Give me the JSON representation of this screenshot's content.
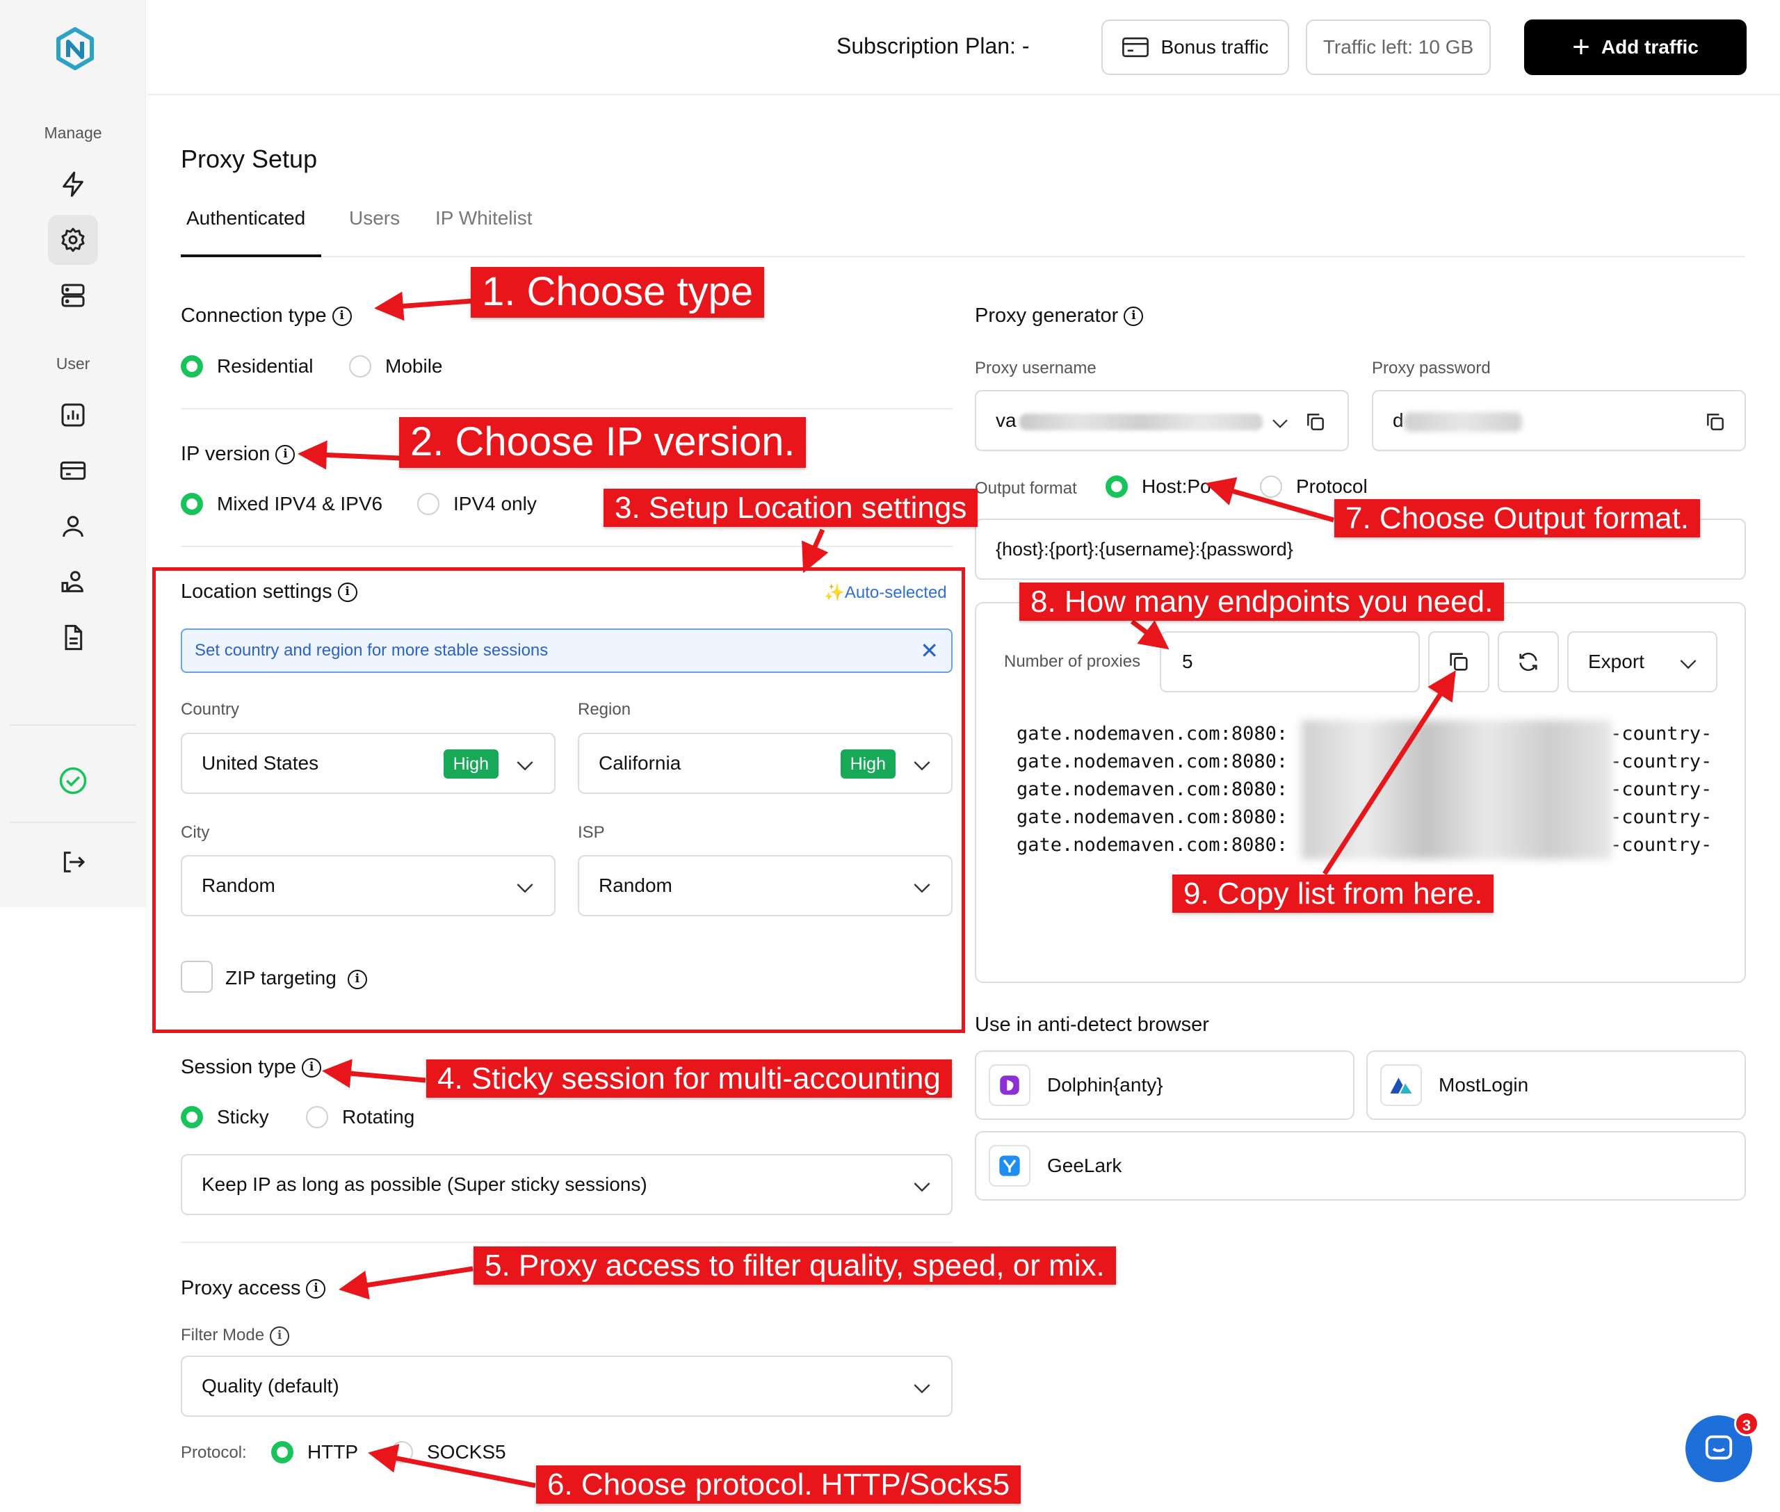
{
  "topbar": {
    "subscription_label": "Subscription Plan: -",
    "bonus_traffic": "Bonus traffic",
    "traffic_left": "Traffic left: 10 GB",
    "add_traffic": "Add traffic"
  },
  "sidebar": {
    "manage_label": "Manage",
    "user_label": "User",
    "items": [
      "bolt-icon",
      "gear-icon",
      "server-icon",
      "chart-icon",
      "card-icon",
      "person-icon",
      "team-icon",
      "document-icon",
      "check-circle-icon",
      "logout-icon"
    ]
  },
  "page": {
    "title": "Proxy Setup",
    "tabs": [
      "Authenticated",
      "Users",
      "IP Whitelist"
    ]
  },
  "connection": {
    "title": "Connection type",
    "options": [
      "Residential",
      "Mobile"
    ],
    "selected": "Residential"
  },
  "ip_version": {
    "title": "IP version",
    "options": [
      "Mixed IPV4 & IPV6",
      "IPV4 only"
    ],
    "selected": "Mixed IPV4 & IPV6"
  },
  "location": {
    "title": "Location settings",
    "auto": "✨Auto-selected",
    "banner": "Set country and region for more stable sessions",
    "country_label": "Country",
    "country_value": "United States",
    "country_badge": "High",
    "region_label": "Region",
    "region_value": "California",
    "region_badge": "High",
    "city_label": "City",
    "city_value": "Random",
    "isp_label": "ISP",
    "isp_value": "Random",
    "zip_label": "ZIP targeting"
  },
  "session": {
    "title": "Session type",
    "options": [
      "Sticky",
      "Rotating"
    ],
    "selected": "Sticky",
    "mode_value": "Keep IP as long as possible (Super sticky sessions)"
  },
  "proxy_access": {
    "title": "Proxy access",
    "filter_label": "Filter Mode",
    "filter_value": "Quality (default)",
    "protocol_label": "Protocol:",
    "protocol_options": [
      "HTTP",
      "SOCKS5"
    ],
    "protocol_selected": "HTTP"
  },
  "generator": {
    "title": "Proxy generator",
    "username_label": "Proxy username",
    "username_value": "va",
    "password_label": "Proxy password",
    "password_value": "d",
    "output_label": "Output format",
    "output_options": [
      "Host:Po",
      "Protocol"
    ],
    "output_selected": "Host:Po",
    "format_value": "{host}:{port}:{username}:{password}",
    "number_label": "Number of proxies",
    "number_value": "5",
    "export_label": "Export",
    "lines": [
      {
        "left": "gate.nodemaven.com:8080:",
        "right": "-country-"
      },
      {
        "left": "gate.nodemaven.com:8080:",
        "right": "-country-"
      },
      {
        "left": "gate.nodemaven.com:8080:",
        "right": "-country-"
      },
      {
        "left": "gate.nodemaven.com:8080:",
        "right": "-country-"
      },
      {
        "left": "gate.nodemaven.com:8080:",
        "right": "-country-"
      }
    ]
  },
  "antidetect": {
    "title": "Use in anti-detect browser",
    "browsers": [
      "Dolphin{anty}",
      "MostLogin",
      "GeeLark"
    ]
  },
  "chat": {
    "badge": "3"
  },
  "annotations": {
    "a1": "1. Choose type",
    "a2": "2. Choose IP version.",
    "a3": "3. Setup Location settings",
    "a4": "4. Sticky session for multi-accounting",
    "a5": "5. Proxy access to filter quality, speed, or mix.",
    "a6": "6. Choose protocol. HTTP/Socks5",
    "a7": "7. Choose Output format.",
    "a8": "8. How many endpoints you need.",
    "a9": "9. Copy list from here."
  }
}
